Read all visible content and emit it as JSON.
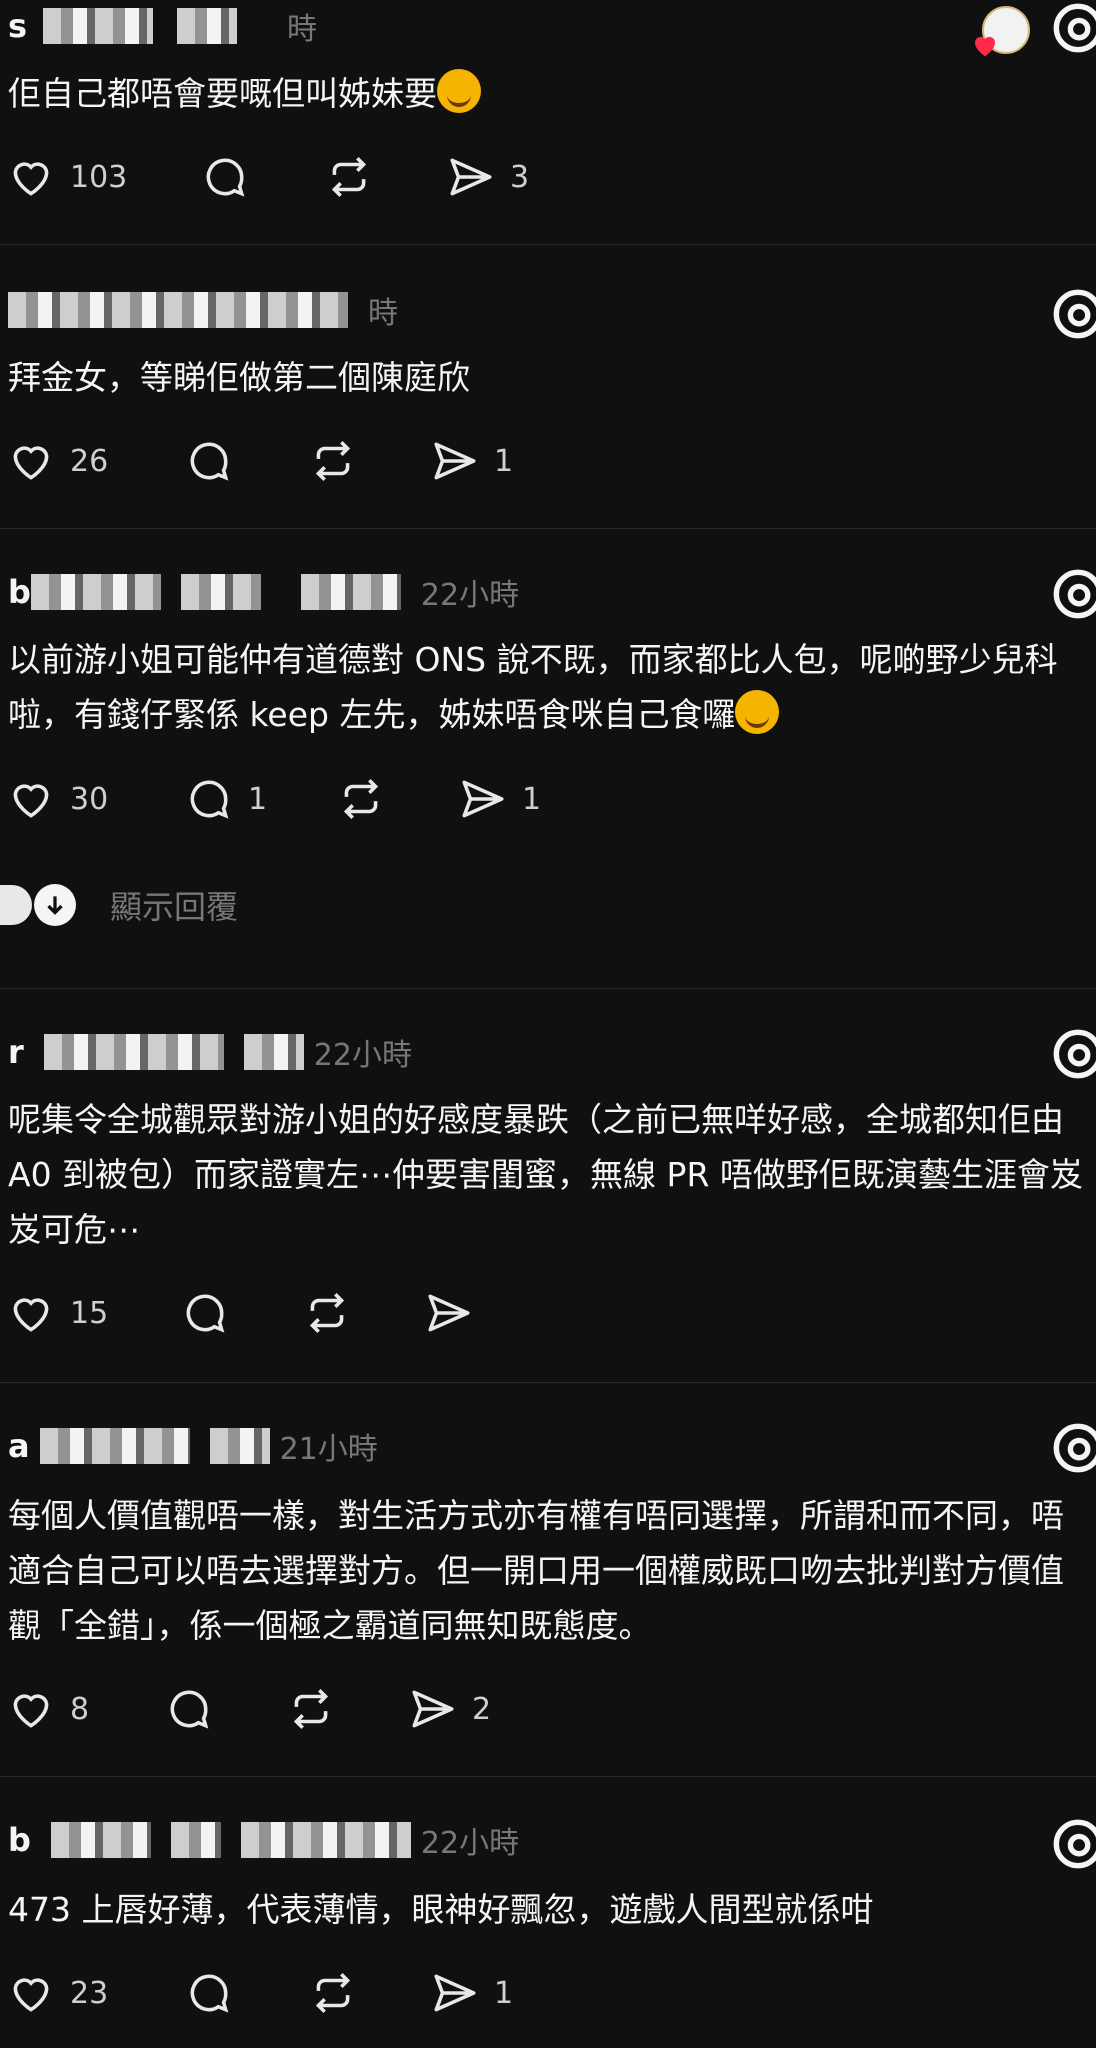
{
  "posts": [
    {
      "username": "s",
      "time": "時",
      "text": "佢自己都唔會要嘅但叫姊妹要",
      "emoji": "rolling-on-floor-laughing",
      "likes": "103",
      "replies": "",
      "reposts": "",
      "shares": "3"
    },
    {
      "username": "",
      "time": "時",
      "text": "拜金女，等睇佢做第二個陳庭欣",
      "likes": "26",
      "replies": "",
      "reposts": "",
      "shares": "1"
    },
    {
      "username": "b",
      "time": "22小時",
      "text": "以前游小姐可能仲有道德對 ONS 說不既，而家都比人包，呢啲野少兒科啦，有錢仔緊係 keep 左先，姊妹唔食咪自己食囉",
      "emoji": "smirking-face",
      "likes": "30",
      "replies": "1",
      "reposts": "",
      "shares": "1"
    },
    {
      "username": "r",
      "time": "22小時",
      "text": "呢集令全城觀眾對游小姐的好感度暴跌（之前已無咩好感，全城都知佢由 A0 到被包）而家證實左⋯仲要害閨蜜，無線 PR 唔做野佢既演藝生涯會岌岌可危⋯",
      "likes": "15",
      "replies": "",
      "reposts": "",
      "shares": ""
    },
    {
      "username": "a",
      "time": "21小時",
      "text": "每個人價值觀唔一樣，對生活方式亦有權有唔同選擇，所謂和而不同，唔適合自己可以唔去選擇對方。但一開口用一個權威既口吻去批判對方價值觀「全錯」，係一個極之霸道同無知既態度。",
      "likes": "8",
      "replies": "",
      "reposts": "",
      "shares": "2"
    },
    {
      "username": "b",
      "time": "22小時",
      "text": "473 上唇好薄，代表薄情，眼神好飄忽，遊戲人間型就係咁",
      "likes": "23",
      "replies": "",
      "reposts": "",
      "shares": "1"
    }
  ],
  "show_replies_label": "顯示回覆",
  "icons": {
    "like": "heart-icon",
    "reply": "comment-icon",
    "repost": "repost-icon",
    "share": "send-icon",
    "logo": "threads-icon"
  },
  "colors": {
    "background": "#101010",
    "text": "#f3f5f7",
    "muted": "#777777",
    "divider": "#2a2a2a"
  }
}
